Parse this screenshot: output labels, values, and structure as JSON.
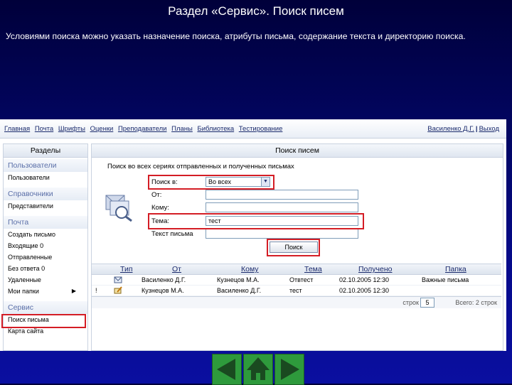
{
  "slide": {
    "title": "Раздел «Сервис». Поиск писем",
    "description": "Условиями поиска можно указать назначение поиска, атрибуты письма, содержание текста и директорию поиска."
  },
  "topnav": {
    "links": [
      "Главная",
      "Почта",
      "Шрифты",
      "Оценки",
      "Преподаватели",
      "Планы",
      "Библиотека",
      "Тестирование"
    ],
    "user": "Василенко Д.Г.",
    "separator": "|",
    "logout": "Выход"
  },
  "sidebar": {
    "title": "Разделы",
    "sections": [
      {
        "header": "Пользователи",
        "items": [
          {
            "label": "Пользователи"
          }
        ]
      },
      {
        "header": "Справочники",
        "items": [
          {
            "label": "Представители"
          }
        ]
      },
      {
        "header": "Почта",
        "items": [
          {
            "label": "Создать письмо"
          },
          {
            "label": "Входящие 0"
          },
          {
            "label": "Отправленные"
          },
          {
            "label": "Без ответа 0"
          },
          {
            "label": "Удаленные"
          },
          {
            "label": "Мои папки",
            "arrow": "▶"
          }
        ]
      },
      {
        "header": "Сервис",
        "items": [
          {
            "label": "Поиск письма"
          },
          {
            "label": "Карта сайта"
          }
        ]
      }
    ]
  },
  "main": {
    "title": "Поиск писем",
    "intro": "Поиск во всех сериях отправленных и полученных письмах",
    "form": {
      "search_in_label": "Поиск в:",
      "search_in_value": "Во всех",
      "from_label": "От:",
      "to_label": "Кому:",
      "subject_label": "Тема:",
      "subject_value": "тест",
      "text_label": "Текст письма",
      "submit_label": "Поиск"
    },
    "table": {
      "headers": [
        "Тип",
        "От",
        "Кому",
        "Тема",
        "Получено",
        "Папка"
      ],
      "rows": [
        {
          "flag": "",
          "type_icon": "letter-icon",
          "from": "Василенко Д.Г.",
          "to": "Кузнецов М.А.",
          "subject": "Отвтест",
          "received": "02.10.2005 12:30",
          "folder": "Важные письма"
        },
        {
          "flag": "!",
          "type_icon": "letter-pen-icon",
          "from": "Кузнецов М.А.",
          "to": "Василенко Д.Г.",
          "subject": "тест",
          "received": "02.10.2005 12:30",
          "folder": ""
        }
      ]
    },
    "pager": {
      "rows_label": "строк",
      "rows_value": "5",
      "total_label": "Всего: 2 строк"
    }
  },
  "nav": {
    "buttons": [
      "previous-icon",
      "home-icon",
      "next-icon"
    ]
  }
}
